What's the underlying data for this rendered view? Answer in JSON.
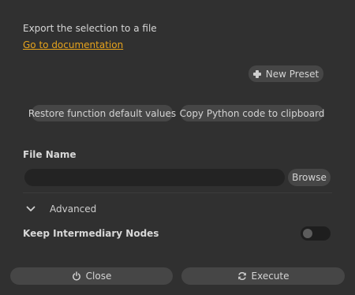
{
  "header": {
    "description": "Export the selection to a file",
    "doc_link": "Go to documentation"
  },
  "presets": {
    "new_preset_label": "New Preset",
    "new_preset_icon": "plus-icon"
  },
  "actions": {
    "restore_label": "Restore function default values",
    "copy_label": "Copy Python code to clipboard"
  },
  "file": {
    "label": "File Name",
    "value": "",
    "browse_label": "Browse"
  },
  "advanced": {
    "label": "Advanced",
    "icon": "chevron-down-icon",
    "expanded": true
  },
  "options": {
    "keep_intermediary_label": "Keep Intermediary Nodes",
    "keep_intermediary_value": false
  },
  "footer": {
    "close_label": "Close",
    "close_icon": "power-icon",
    "execute_label": "Execute",
    "execute_icon": "refresh-icon"
  },
  "colors": {
    "background": "#303030",
    "button": "#464646",
    "input": "#232323",
    "link": "#e6a31c"
  }
}
